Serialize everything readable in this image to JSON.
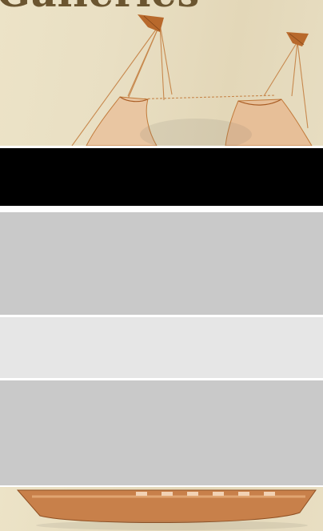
{
  "header": {
    "title": "Galleries"
  },
  "icons": {
    "header_image": "sailing-ship-illustration",
    "footer_image": "ship-hull-illustration"
  },
  "colors": {
    "title": "#6b5530",
    "sail": "#e7bf98",
    "hull": "#c8804a",
    "band": "#000000",
    "panel_dark": "#c9c9c9",
    "panel_light": "#e6e6e6"
  }
}
